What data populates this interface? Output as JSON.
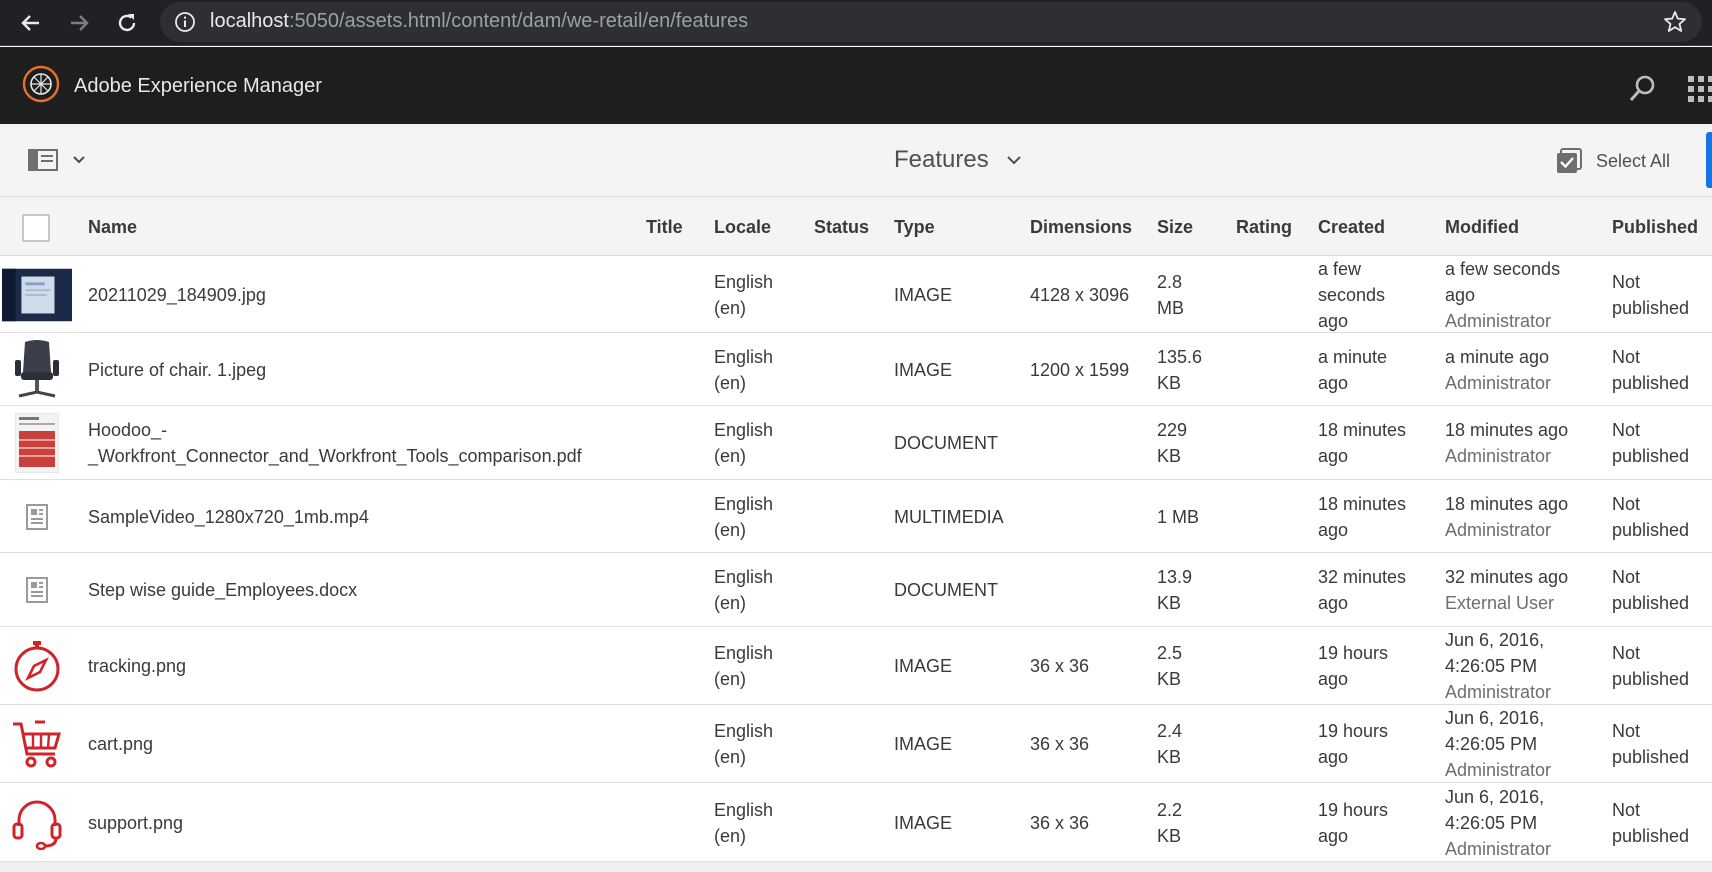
{
  "browser": {
    "url_host": "localhost",
    "url_rest": ":5050/assets.html/content/dam/we-retail/en/features"
  },
  "app": {
    "title": "Adobe Experience Manager",
    "accent_color": "#1473e6",
    "brand_color": "#e8702a"
  },
  "toolbar": {
    "title": "Features",
    "select_all": "Select All"
  },
  "columns": {
    "name": "Name",
    "title": "Title",
    "locale": "Locale",
    "status": "Status",
    "type": "Type",
    "dimensions": "Dimensions",
    "size": "Size",
    "rating": "Rating",
    "created": "Created",
    "modified": "Modified",
    "published": "Published"
  },
  "rows": [
    {
      "thumb": "photo-thumbnail",
      "name": "20211029_184909.jpg",
      "locale": [
        "English",
        "(en)"
      ],
      "type": "IMAGE",
      "dimensions": "4128 x 3096",
      "size": [
        "2.8",
        "MB"
      ],
      "created": [
        "a few",
        "seconds",
        "ago"
      ],
      "modified": [
        "a few seconds",
        "ago"
      ],
      "modified_by": "Administrator",
      "published": [
        "Not",
        "published"
      ]
    },
    {
      "thumb": "chair-thumbnail",
      "name": "Picture of chair. 1.jpeg",
      "locale": [
        "English",
        "(en)"
      ],
      "type": "IMAGE",
      "dimensions": "1200 x 1599",
      "size": [
        "135.6",
        "KB"
      ],
      "created": [
        "a minute",
        "ago"
      ],
      "modified": [
        "a minute ago"
      ],
      "modified_by": "Administrator",
      "published": [
        "Not",
        "published"
      ]
    },
    {
      "thumb": "pdf-thumbnail",
      "name": [
        "Hoodoo_-",
        "_Workfront_Connector_and_Workfront_Tools_comparison.pdf"
      ],
      "locale": [
        "English",
        "(en)"
      ],
      "type": "DOCUMENT",
      "dimensions": "",
      "size": [
        "229",
        "KB"
      ],
      "created": [
        "18 minutes",
        "ago"
      ],
      "modified": [
        "18 minutes ago"
      ],
      "modified_by": "Administrator",
      "published": [
        "Not",
        "published"
      ]
    },
    {
      "thumb": "file-icon",
      "name": "SampleVideo_1280x720_1mb.mp4",
      "locale": [
        "English",
        "(en)"
      ],
      "type": "MULTIMEDIA",
      "dimensions": "",
      "size": [
        "1 MB"
      ],
      "created": [
        "18 minutes",
        "ago"
      ],
      "modified": [
        "18 minutes ago"
      ],
      "modified_by": "Administrator",
      "published": [
        "Not",
        "published"
      ]
    },
    {
      "thumb": "file-icon",
      "name": "Step wise guide_Employees.docx",
      "locale": [
        "English",
        "(en)"
      ],
      "type": "DOCUMENT",
      "dimensions": "",
      "size": [
        "13.9",
        "KB"
      ],
      "created": [
        "32 minutes",
        "ago"
      ],
      "modified": [
        "32 minutes ago"
      ],
      "modified_by": "External User",
      "published": [
        "Not",
        "published"
      ]
    },
    {
      "thumb": "compass-icon",
      "name": "tracking.png",
      "locale": [
        "English",
        "(en)"
      ],
      "type": "IMAGE",
      "dimensions": "36 x 36",
      "size": [
        "2.5",
        "KB"
      ],
      "created": [
        "19 hours",
        "ago"
      ],
      "modified": [
        "Jun 6, 2016,",
        "4:26:05 PM"
      ],
      "modified_by": "Administrator",
      "published": [
        "Not",
        "published"
      ]
    },
    {
      "thumb": "cart-icon",
      "name": "cart.png",
      "locale": [
        "English",
        "(en)"
      ],
      "type": "IMAGE",
      "dimensions": "36 x 36",
      "size": [
        "2.4",
        "KB"
      ],
      "created": [
        "19 hours",
        "ago"
      ],
      "modified": [
        "Jun 6, 2016,",
        "4:26:05 PM"
      ],
      "modified_by": "Administrator",
      "published": [
        "Not",
        "published"
      ]
    },
    {
      "thumb": "headset-icon",
      "name": "support.png",
      "locale": [
        "English",
        "(en)"
      ],
      "type": "IMAGE",
      "dimensions": "36 x 36",
      "size": [
        "2.2",
        "KB"
      ],
      "created": [
        "19 hours",
        "ago"
      ],
      "modified": [
        "Jun 6, 2016,",
        "4:26:05 PM"
      ],
      "modified_by": "Administrator",
      "published": [
        "Not",
        "published"
      ]
    }
  ]
}
